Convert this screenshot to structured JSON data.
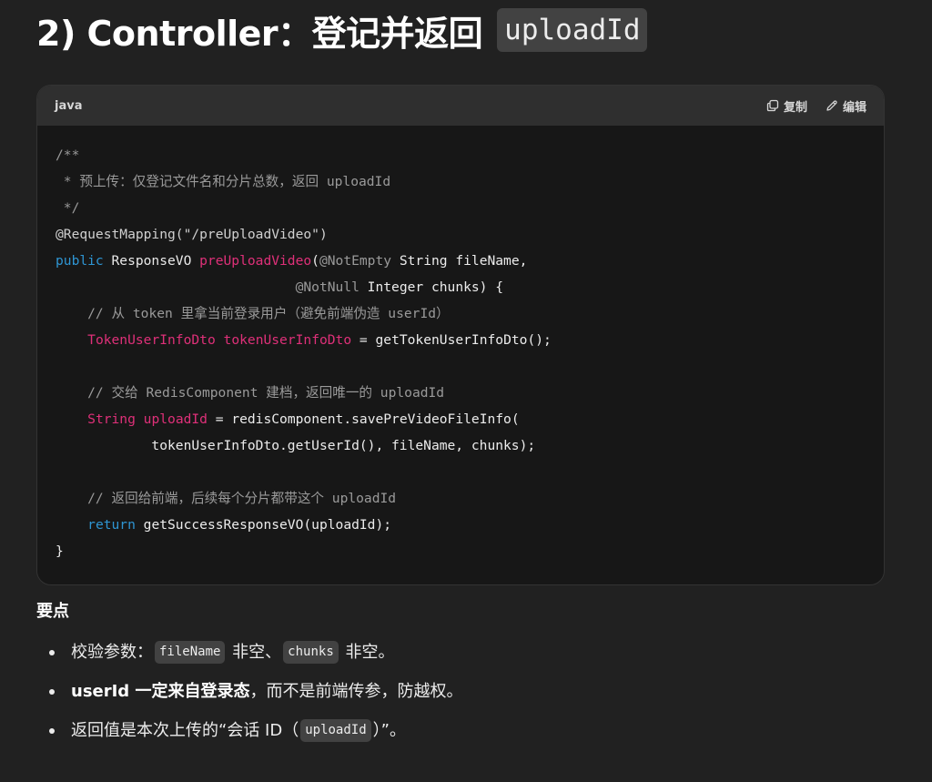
{
  "heading": {
    "text": "2) Controller：登记并返回",
    "code": "uploadId"
  },
  "code_block": {
    "language": "java",
    "copy_label": "复制",
    "edit_label": "编辑",
    "copy_icon": "copy-icon",
    "edit_icon": "pencil-icon",
    "lines": [
      [
        {
          "t": "/**",
          "c": "comment"
        }
      ],
      [
        {
          "t": " * 预上传：仅登记文件名和分片总数，返回 uploadId",
          "c": "comment"
        }
      ],
      [
        {
          "t": " */",
          "c": "comment"
        }
      ],
      [
        {
          "t": "@RequestMapping(\"/preUploadVideo\")",
          "c": "anno"
        }
      ],
      [
        {
          "t": "public",
          "c": "kw"
        },
        {
          "t": " ResponseVO ",
          "c": "type"
        },
        {
          "t": "preUploadVideo",
          "c": "fn"
        },
        {
          "t": "(",
          "c": "plain"
        },
        {
          "t": "@NotEmpty",
          "c": "comment"
        },
        {
          "t": " String fileName,",
          "c": "plain"
        }
      ],
      [
        {
          "t": "                              ",
          "c": "plain"
        },
        {
          "t": "@NotNull",
          "c": "comment"
        },
        {
          "t": " Integer chunks) {",
          "c": "plain"
        }
      ],
      [
        {
          "t": "    // 从 token 里拿当前登录用户（避免前端伪造 userId）",
          "c": "comment"
        }
      ],
      [
        {
          "t": "    ",
          "c": "plain"
        },
        {
          "t": "TokenUserInfoDto",
          "c": "var"
        },
        {
          "t": " ",
          "c": "plain"
        },
        {
          "t": "tokenUserInfoDto",
          "c": "var"
        },
        {
          "t": " = getTokenUserInfoDto();",
          "c": "plain"
        }
      ],
      [
        {
          "t": "",
          "c": "plain"
        }
      ],
      [
        {
          "t": "    // 交给 RedisComponent 建档，返回唯一的 uploadId",
          "c": "comment"
        }
      ],
      [
        {
          "t": "    ",
          "c": "plain"
        },
        {
          "t": "String",
          "c": "var"
        },
        {
          "t": " ",
          "c": "plain"
        },
        {
          "t": "uploadId",
          "c": "var"
        },
        {
          "t": " = redisComponent.savePreVideoFileInfo(",
          "c": "plain"
        }
      ],
      [
        {
          "t": "            tokenUserInfoDto.getUserId(), fileName, chunks);",
          "c": "plain"
        }
      ],
      [
        {
          "t": "",
          "c": "plain"
        }
      ],
      [
        {
          "t": "    // 返回给前端，后续每个分片都带这个 uploadId",
          "c": "comment"
        }
      ],
      [
        {
          "t": "    ",
          "c": "plain"
        },
        {
          "t": "return",
          "c": "kw"
        },
        {
          "t": " getSuccessResponseVO(uploadId);",
          "c": "plain"
        }
      ],
      [
        {
          "t": "}",
          "c": "plain"
        }
      ]
    ]
  },
  "key_points": {
    "title": "要点",
    "items": [
      {
        "parts": [
          {
            "t": "校验参数：",
            "k": "text"
          },
          {
            "t": "fileName",
            "k": "code"
          },
          {
            "t": " 非空、",
            "k": "text"
          },
          {
            "t": "chunks",
            "k": "code"
          },
          {
            "t": " 非空。",
            "k": "text"
          }
        ]
      },
      {
        "parts": [
          {
            "t": "userId 一定来自登录态",
            "k": "strong"
          },
          {
            "t": "，而不是前端传参，防越权。",
            "k": "text"
          }
        ]
      },
      {
        "parts": [
          {
            "t": "返回值是本次上传的“会话 ID（",
            "k": "text"
          },
          {
            "t": "uploadId",
            "k": "code"
          },
          {
            "t": "）”。",
            "k": "text"
          }
        ]
      }
    ]
  }
}
